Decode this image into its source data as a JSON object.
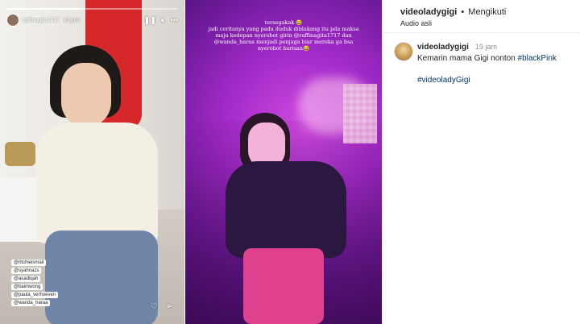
{
  "story": {
    "username": "raffinagita1717",
    "time": "16 jam",
    "progress_fraction": 0.45,
    "icons": {
      "pause": "pause-icon",
      "mute": "speaker-icon",
      "more": "more-icon",
      "like": "heart-icon",
      "share": "send-icon"
    },
    "tags": [
      "@ritchieismail",
      "@syahnazs",
      "@asadiqah",
      "@baimwong",
      "@paula_verhoeven",
      "@wanda_haraa"
    ]
  },
  "video": {
    "caption_lines": [
      "tersegakak 😂",
      "jadi ceritanya yang pada duduk diblakang itu pda maksa",
      "maju kedepan nyerobot girin @raffinagita1717 dan",
      "@wanda_haraa menjadi penjaga biar mereka ga bsa",
      "nyerobot barisan😂"
    ]
  },
  "post": {
    "account": "videoladygigi",
    "separator": "•",
    "follow_status": "Mengikuti",
    "audio": "Audio asli",
    "comment": {
      "author": "videoladygigi",
      "time": "19 jam",
      "text_plain": "Kemarin mama Gigi nonton ",
      "text_hashtag": "#blackPink",
      "hashtag_line": "#videoladyGigi"
    }
  },
  "colors": {
    "link": "#00376b",
    "muted": "#8e8e8e",
    "text": "#262626"
  }
}
